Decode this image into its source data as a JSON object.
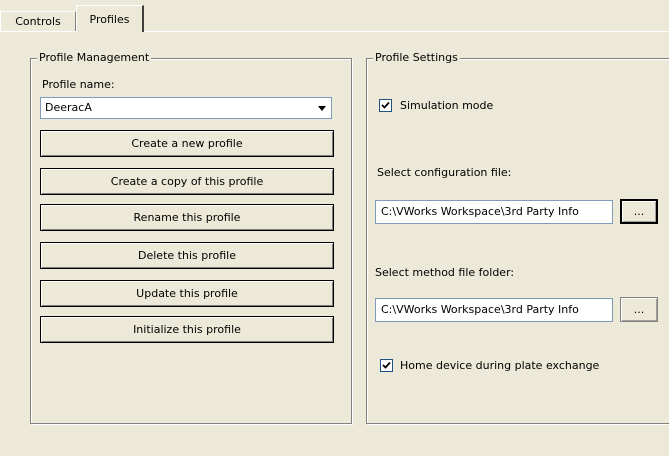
{
  "tabs": [
    {
      "label": "Controls",
      "selected": false
    },
    {
      "label": "Profiles",
      "selected": true
    }
  ],
  "profile_management": {
    "legend": "Profile Management",
    "name_label": "Profile name:",
    "selected_profile": "DeeracA",
    "buttons": [
      "Create a new profile",
      "Create a copy of this profile",
      "Rename this profile",
      "Delete this profile",
      "Update this profile",
      "Initialize this profile"
    ]
  },
  "profile_settings": {
    "legend": "Profile Settings",
    "simulation_label": "Simulation mode",
    "simulation_checked": true,
    "config_label": "Select configuration file:",
    "config_value": "C:\\VWorks Workspace\\3rd Party Info",
    "config_browse": "...",
    "method_label": "Select method file folder:",
    "method_value": "C:\\VWorks Workspace\\3rd Party Info",
    "method_browse": "...",
    "home_label": "Home device during plate exchange",
    "home_checked": true
  }
}
